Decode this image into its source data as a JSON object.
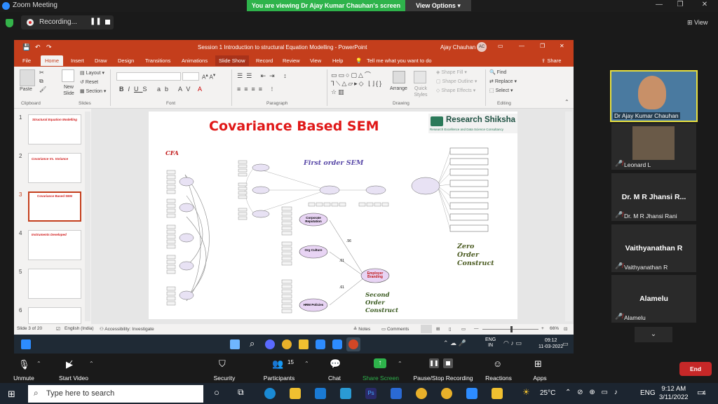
{
  "zoom": {
    "window_title": "Zoom Meeting",
    "viewing_banner": "You are viewing Dr Ajay Kumar Chauhan's screen",
    "view_options": "View Options",
    "recording_label": "Recording...",
    "view_label": "View",
    "toolbar": {
      "unmute": "Unmute",
      "start_video": "Start Video",
      "security": "Security",
      "participants": "Participants",
      "participants_count": "15",
      "chat": "Chat",
      "share_screen": "Share Screen",
      "pause_recording": "Pause/Stop Recording",
      "reactions": "Reactions",
      "apps": "Apps",
      "end": "End"
    },
    "participants": [
      {
        "display": "",
        "caption": "Dr Ajay Kumar Chauhan",
        "type": "video"
      },
      {
        "display": "",
        "caption": "Leonard L",
        "type": "video"
      },
      {
        "display": "Dr. M R Jhansi R...",
        "caption": "Dr. M R Jhansi Rani",
        "type": "name"
      },
      {
        "display": "Vaithyanathan R",
        "caption": "Vaithyanathan R",
        "type": "name"
      },
      {
        "display": "Alamelu",
        "caption": "Alamelu",
        "type": "name"
      }
    ]
  },
  "powerpoint": {
    "title": "Session 1 Introduction to structural Equation Modelling  -  PowerPoint",
    "user": "Ajay Chauhan",
    "user_initials": "AC",
    "tabs": [
      "File",
      "Home",
      "Insert",
      "Draw",
      "Design",
      "Transitions",
      "Animations",
      "Slide Show",
      "Record",
      "Review",
      "View",
      "Help"
    ],
    "active_tab": "Home",
    "tell_me": "Tell me what you want to do",
    "share": "Share",
    "ribbon": {
      "paste": "Paste",
      "new_slide": "New Slide",
      "layout": "Layout",
      "reset": "Reset",
      "section": "Section",
      "arrange": "Arrange",
      "quick_styles": "Quick Styles",
      "shape_fill": "Shape Fill",
      "shape_outline": "Shape Outline",
      "shape_effects": "Shape Effects",
      "find": "Find",
      "replace": "Replace",
      "select": "Select",
      "groups": [
        "Clipboard",
        "Slides",
        "Font",
        "Paragraph",
        "Drawing",
        "Editing"
      ]
    },
    "thumbnails": [
      {
        "num": "1",
        "title": "Structural Equation Modelling"
      },
      {
        "num": "2",
        "title": "Covariance Vs. Variance"
      },
      {
        "num": "3",
        "title": "Covariance Based SEM"
      },
      {
        "num": "4",
        "title": "Instruments Developed"
      },
      {
        "num": "5",
        "title": ""
      },
      {
        "num": "6",
        "title": ""
      }
    ],
    "status": {
      "slide": "Slide 3 of 20",
      "language": "English (India)",
      "accessibility": "Accessibility: Investigate",
      "notes": "Notes",
      "comments": "Comments",
      "zoom": "66%"
    },
    "slide": {
      "title": "Covariance Based SEM",
      "brand": "Research Shiksha",
      "brand_sub": "Research Excellence and Data Science Consultancy",
      "cfa": "CFA",
      "first_order": "First order SEM",
      "zero_order": [
        "Zero",
        "Order",
        "Construct"
      ],
      "second_order": [
        "Second",
        "Order",
        "Construct"
      ],
      "nodes": {
        "corporate": "Corporate Reputation",
        "org_culture": "Org Culture",
        "hrm": "HRM Policies",
        "employer": "Employer Branding",
        "coef1": ".56",
        "coef2": ".61",
        "coef3": ".61"
      }
    }
  },
  "inner_taskbar": {
    "lang": "ENG",
    "region": "IN",
    "time": "09:12",
    "date": "11-03-2022"
  },
  "windows": {
    "search_placeholder": "Type here to search",
    "temp": "25°C",
    "lang": "ENG",
    "time": "9:12 AM",
    "date": "3/11/2022",
    "notifications": "4"
  }
}
